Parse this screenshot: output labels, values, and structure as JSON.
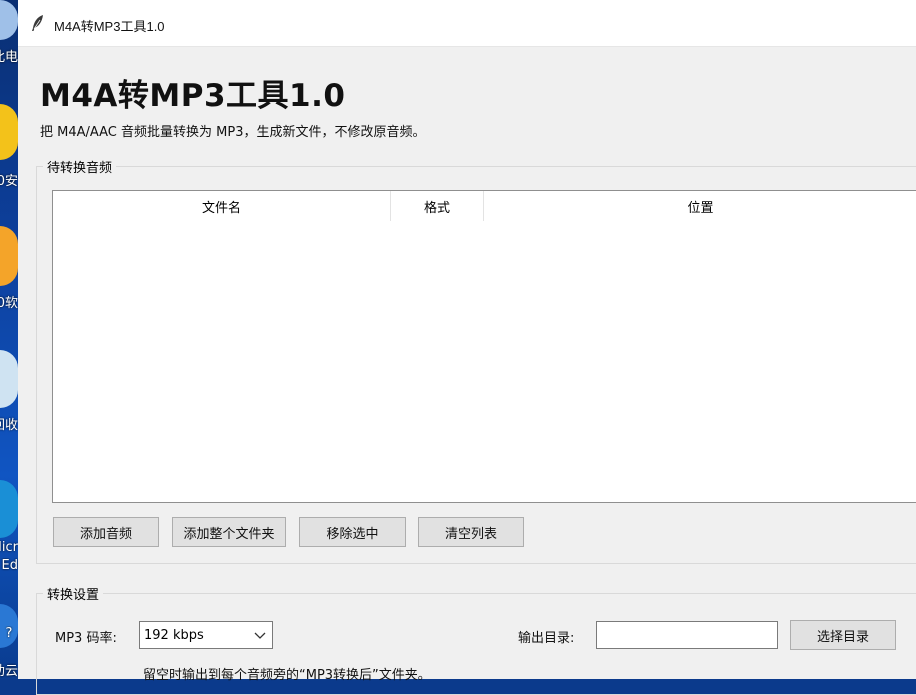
{
  "desktop": {
    "labels": [
      "此电",
      "0安",
      "0软",
      "回收",
      "Micr",
      "Ed",
      "?",
      "助云"
    ]
  },
  "window": {
    "title": "M4A转MP3工具1.0"
  },
  "header": {
    "title": "M4A转MP3工具1.0",
    "subtitle": "把 M4A/AAC 音频批量转换为 MP3，生成新文件，不修改原音频。"
  },
  "queue": {
    "group_label": "待转换音频",
    "columns": [
      "文件名",
      "格式",
      "位置"
    ],
    "rows": [],
    "buttons": {
      "add_audio": "添加音频",
      "add_folder": "添加整个文件夹",
      "remove_selected": "移除选中",
      "clear_list": "清空列表"
    }
  },
  "settings": {
    "group_label": "转换设置",
    "bitrate_label": "MP3 码率:",
    "bitrate_value": "192 kbps",
    "output_dir_label": "输出目录:",
    "output_dir_value": "",
    "choose_dir_button": "选择目录",
    "hint": "留空时输出到每个音频旁的“MP3转换后”文件夹。"
  }
}
